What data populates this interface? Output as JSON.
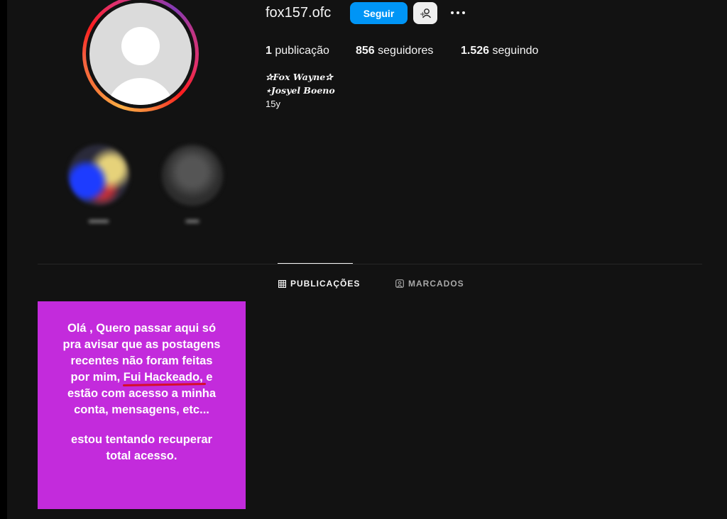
{
  "profile": {
    "username": "fox157.ofc",
    "follow_label": "Seguir",
    "stats": {
      "posts_count": "1",
      "posts_label": "publicação",
      "followers_count": "856",
      "followers_label": "seguidores",
      "following_count": "1.526",
      "following_label": "seguindo"
    },
    "bio": {
      "line1": "✰Fox Wayne✰",
      "line2": "⋆Josyel Boeno",
      "line3": "15y"
    },
    "ring_colors": [
      "#fcaf45",
      "#f77737",
      "#fd1d1d",
      "#e1306c",
      "#c13584",
      "#833ab4"
    ]
  },
  "highlights": [
    {
      "name": "highlight-1",
      "icon": "highlight-cover"
    },
    {
      "name": "highlight-2",
      "icon": "highlight-cover"
    }
  ],
  "tabs": [
    {
      "label": "PUBLICAÇÕES",
      "icon": "grid-icon",
      "active": true
    },
    {
      "label": "MARCADOS",
      "icon": "tagged-icon",
      "active": false
    }
  ],
  "post": {
    "background": "#c32bdc",
    "paragraph1": "Olá , Quero passar aqui só pra avisar que as postagens recentes não foram feitas por mim, Fui Hackeado, e estão com acesso a minha conta, mensagens, etc...",
    "paragraph1_lines": [
      "Olá , Quero passar aqui só",
      "pra avisar que as postagens",
      "recentes não foram feitas",
      "por mim, Fui Hackeado, e",
      "estão com acesso a minha",
      "conta, mensagens, etc..."
    ],
    "paragraph2_lines": [
      "estou tentando recuperar",
      "total acesso."
    ],
    "underlined_text": "Fui Hackeado"
  },
  "colors": {
    "background": "#121212",
    "accent_blue": "#0095f6",
    "underline_red": "#d60d2a"
  }
}
